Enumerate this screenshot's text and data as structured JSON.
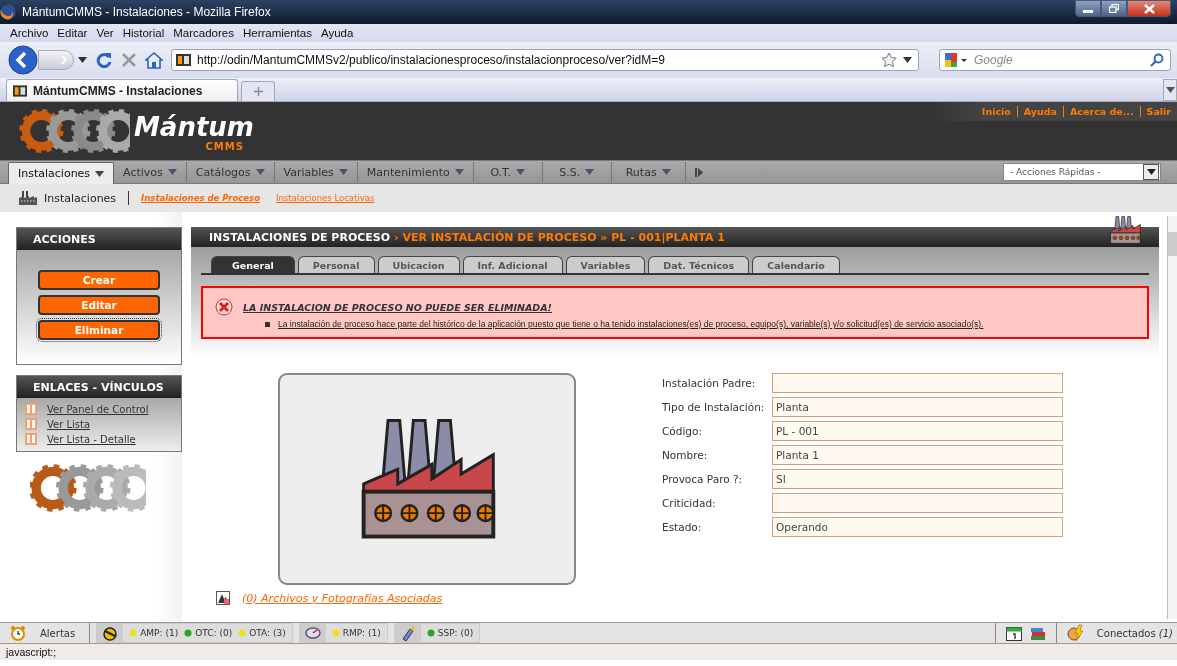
{
  "window": {
    "title": "MántumCMMS - Instalaciones - Mozilla Firefox"
  },
  "menu_bar": [
    "Archivo",
    "Editar",
    "Ver",
    "Historial",
    "Marcadores",
    "Herramientas",
    "Ayuda"
  ],
  "address_bar": {
    "url": "http://odin/MantumCMMSv2/publico/instalacionesproceso/instalacionproceso/ver?idM=9"
  },
  "search": {
    "placeholder": "Google"
  },
  "browser_tabs": [
    {
      "label": "MántumCMMS - Instalaciones",
      "selected": true
    }
  ],
  "header": {
    "brand": "Mántum",
    "subbrand": "CMMS",
    "links": [
      "Inicio",
      "Ayuda",
      "Acerca de...",
      "Salir"
    ]
  },
  "main_menu": [
    {
      "label": "Instalaciones",
      "selected": true
    },
    {
      "label": "Activos",
      "selected": false
    },
    {
      "label": "Catálogos",
      "selected": false
    },
    {
      "label": "Variables",
      "selected": false
    },
    {
      "label": "Mantenimiento",
      "selected": false
    },
    {
      "label": "O.T.",
      "selected": false
    },
    {
      "label": "S.S.",
      "selected": false
    },
    {
      "label": "Rutas",
      "selected": false
    }
  ],
  "quick_actions": {
    "value": "- Acciones Rápidas -"
  },
  "sub_nav": {
    "title": "Instalaciones",
    "links": [
      {
        "label": "Instalaciones de Proceso",
        "selected": true
      },
      {
        "label": "Instalaciones Locativas",
        "selected": false
      }
    ]
  },
  "actions": {
    "title": "ACCIONES",
    "buttons": [
      {
        "label": "Crear",
        "focused": false
      },
      {
        "label": "Editar",
        "focused": false
      },
      {
        "label": "Eliminar",
        "focused": true
      }
    ]
  },
  "links_panel": {
    "title": "ENLACES - VÍNCULOS",
    "links": [
      "Ver Panel de Control",
      "Ver Lista",
      "Ver Lista - Detalle"
    ]
  },
  "page": {
    "section": "INSTALACIONES DE PROCESO",
    "breadcrumb": "› VER INSTALACIÓN DE PROCESO » PL - 001|PLANTA 1"
  },
  "tabs": [
    {
      "label": "General",
      "selected": true
    },
    {
      "label": "Personal",
      "selected": false
    },
    {
      "label": "Ubicacion",
      "selected": false
    },
    {
      "label": "Inf. Adicional",
      "selected": false
    },
    {
      "label": "Variables",
      "selected": false
    },
    {
      "label": "Dat. Técnicos",
      "selected": false
    },
    {
      "label": "Calendario",
      "selected": false
    }
  ],
  "error": {
    "title": "LA INSTALACION DE PROCESO NO PUEDE SER ELIMINADA!",
    "items": [
      "La instalación de proceso hace parte del histórico de la aplicación puesto que tiene o ha tenido instalaciones(es) de proceso, equipo(s), variable(s) y/o solicitud(es) de servicio asociado(s)."
    ]
  },
  "fields": [
    {
      "label": "Instalación Padre:"
    },
    {
      "label": "Tipo de Instalación:",
      "value": "Planta"
    },
    {
      "label": "Código:",
      "value": "PL - 001"
    },
    {
      "label": "Nombre:",
      "value": "Planta 1"
    },
    {
      "label": "Provoca Paro ?:",
      "value": "SI"
    },
    {
      "label": "Criticidad:"
    },
    {
      "label": "Estado:",
      "value": "Operando"
    }
  ],
  "attachments": "(0) Archivos y Fotografías Asociadas",
  "status_bar": {
    "alerts_label": "Alertas",
    "groups": [
      {
        "kind": "work_orders",
        "items": [
          {
            "label": "AMP: (1)",
            "color": "#f0e020"
          },
          {
            "label": "OTC: (0)",
            "color": "#2aa52a"
          },
          {
            "label": "OTA: (3)",
            "color": "#f0e020"
          }
        ]
      },
      {
        "kind": "routes",
        "items": [
          {
            "label": "RMP: (1)",
            "color": "#f0e020"
          }
        ]
      },
      {
        "kind": "requests",
        "items": [
          {
            "label": "SSP: (0)",
            "color": "#2aa52a"
          }
        ]
      }
    ],
    "connected": "Conectados *(1)*"
  },
  "status_text": "javascript:;"
}
